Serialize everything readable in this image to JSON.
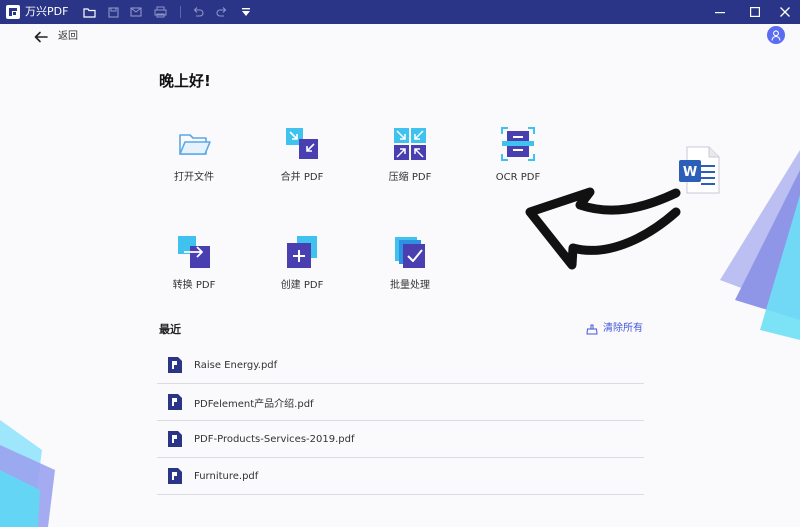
{
  "titlebar": {
    "app_title": "万兴PDF",
    "bg_color": "#2b3587"
  },
  "nav": {
    "back_label": "返回"
  },
  "greeting": "晚上好!",
  "tools": [
    {
      "label": "打开文件",
      "icon": "folder-open-icon"
    },
    {
      "label": "合并 PDF",
      "icon": "merge-pdf-icon"
    },
    {
      "label": "压缩 PDF",
      "icon": "compress-pdf-icon"
    },
    {
      "label": "OCR PDF",
      "icon": "ocr-pdf-icon"
    },
    {
      "label": "转换 PDF",
      "icon": "convert-pdf-icon"
    },
    {
      "label": "创建 PDF",
      "icon": "create-pdf-icon"
    },
    {
      "label": "批量处理",
      "icon": "batch-process-icon"
    }
  ],
  "recent": {
    "title": "最近",
    "clear_label": "清除所有",
    "files": [
      {
        "name": "Raise Energy.pdf"
      },
      {
        "name": "PDFelement产品介绍.pdf"
      },
      {
        "name": "PDF-Products-Services-2019.pdf"
      },
      {
        "name": "Furniture.pdf"
      }
    ]
  },
  "colors": {
    "accent": "#4457d8",
    "avatar": "#5a6cf0",
    "file_icon": "#2b3587"
  }
}
